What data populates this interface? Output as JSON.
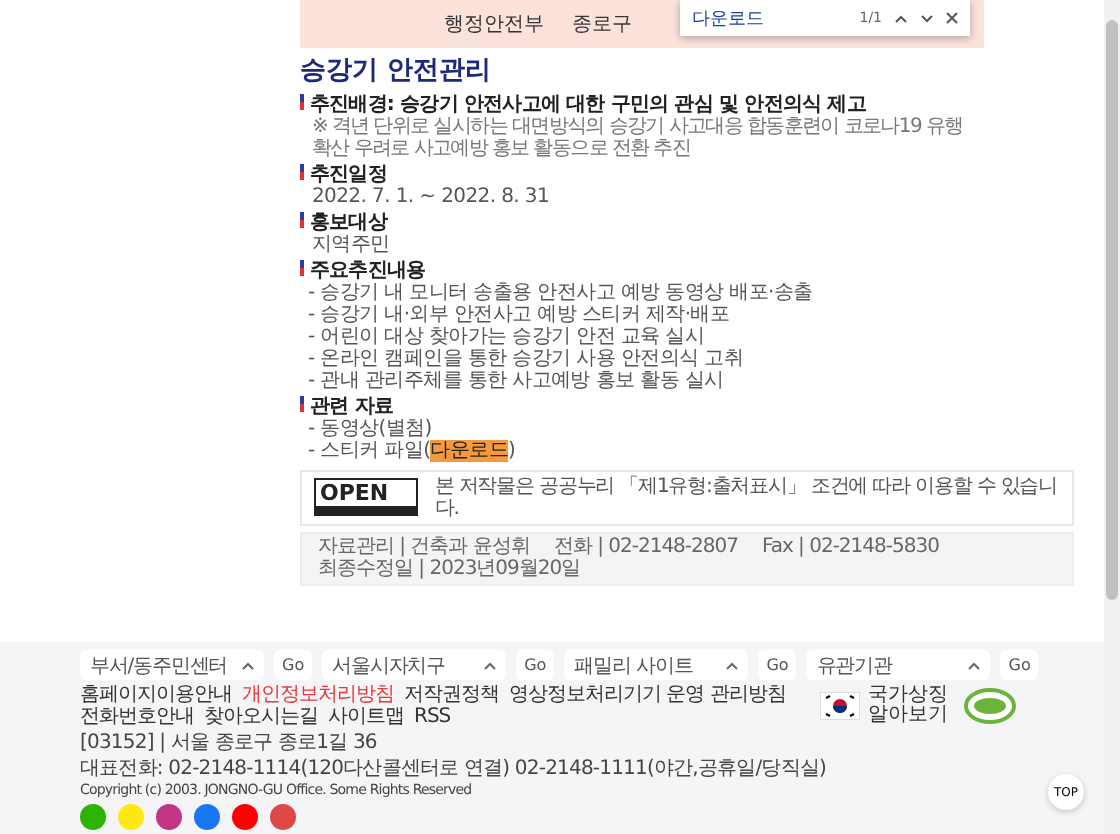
{
  "banner": {
    "logos": [
      "행정안전부",
      "종로구"
    ]
  },
  "find_bar": {
    "query": "다운로드",
    "count": "1/1"
  },
  "title": "승강기 안전관리",
  "sections": [
    {
      "heading": "추진배경: 승강기 안전사고에 대한 구민의 관심 및 안전의식 제고",
      "items": [
        {
          "kind": "note",
          "text": "※ 격년 단위로 실시하는 대면방식의 승강기 사고대응 합동훈련이 코로나19 유행 확산 우려로 사고예방 홍보 활동으로 전환 추진"
        }
      ]
    },
    {
      "heading": "추진일정",
      "items": [
        {
          "kind": "plain",
          "text": "2022. 7. 1. ~ 2022. 8. 31"
        }
      ]
    },
    {
      "heading": "홍보대상",
      "items": [
        {
          "kind": "plain",
          "text": "지역주민"
        }
      ]
    },
    {
      "heading": "주요추진내용",
      "items": [
        {
          "kind": "bullet",
          "text": "- 승강기 내 모니터 송출용 안전사고 예방 동영상 배포·송출"
        },
        {
          "kind": "bullet",
          "text": "- 승강기 내·외부 안전사고 예방 스티커 제작·배포"
        },
        {
          "kind": "bullet",
          "text": "- 어린이 대상 찾아가는 승강기 안전 교육 실시"
        },
        {
          "kind": "bullet",
          "text": "- 온라인 캠페인을 통한 승강기 사용 안전의식 고취"
        },
        {
          "kind": "bullet",
          "text": "- 관내 관리주체를 통한 사고예방 홍보 활동 실시"
        }
      ]
    },
    {
      "heading": "관련 자료",
      "items": [
        {
          "kind": "bullet",
          "text": "- 동영상(별첨)"
        },
        {
          "kind": "match",
          "text": "- 스티커 파일(",
          "match": "다운로드",
          "tail": ")"
        }
      ]
    }
  ],
  "license": {
    "badge": "OPEN",
    "text": "본 저작물은 공공누리 「제1유형:출처표시」 조건에 따라 이용할 수 있습니다."
  },
  "info_bar": [
    "자료관리 | 건축과 윤성휘",
    "전화 | 02-2148-2807",
    "Fax | 02-2148-5830",
    "최종수정일 | 2023년09월20일"
  ],
  "footer": {
    "selects": [
      {
        "label": "부서/동주민센터",
        "button": "Go"
      },
      {
        "label": "서울시자치구",
        "button": "Go"
      },
      {
        "label": "패밀리 사이트",
        "button": "Go"
      },
      {
        "label": "유관기관",
        "button": "Go"
      }
    ],
    "links": [
      {
        "text": "홈페이지이용안내",
        "emphasized": false
      },
      {
        "text": "개인정보처리방침",
        "emphasized": true
      },
      {
        "text": "저작권정책",
        "emphasized": false
      },
      {
        "text": "영상정보처리기기 운영 관리방침",
        "emphasized": false
      },
      {
        "text": "전화번호안내",
        "emphasized": false
      },
      {
        "text": "찾아오시는길",
        "emphasized": false
      },
      {
        "text": "사이트맵",
        "emphasized": false
      },
      {
        "text": "RSS",
        "emphasized": false
      }
    ],
    "symbol_link": "국가상징 알아보기",
    "address": "[03152] | 서울 종로구 종로1길 36",
    "phone": "대표전화: 02-2148-1114(120다산콜센터로 연결) 02-2148-1111(야간,공휴일/당직실)",
    "copyright": "Copyright (c) 2003. JONGNO-GU Office. Some Rights Reserved",
    "socials": [
      {
        "color": "#2db400"
      },
      {
        "color": "#ffe812"
      },
      {
        "color": "#c13584"
      },
      {
        "color": "#1877f2"
      },
      {
        "color": "#ff0000"
      },
      {
        "color": "#e04848"
      }
    ],
    "top_button": "TOP"
  }
}
